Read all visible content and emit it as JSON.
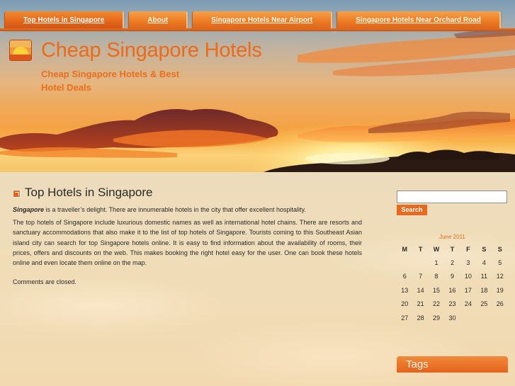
{
  "nav": {
    "items": [
      {
        "label": "Top Hotels in Singapore"
      },
      {
        "label": "About"
      },
      {
        "label": "Singapore Hotels Near Airport"
      },
      {
        "label": "Singapore Hotels Near Orchard Road"
      }
    ]
  },
  "site": {
    "title": "Cheap Singapore Hotels",
    "tagline": "Cheap Singapore Hotels & Best Hotel Deals"
  },
  "post": {
    "title": "Top Hotels in Singapore",
    "intro_bold": "Singapore",
    "intro_rest": " is a traveller’s delight. There are innumerable hotels in the city that offer excellent hospitality.",
    "paragraph": "The top hotels of Singapore include luxurious domestic names as well as international hotel chains. There are resorts and sanctuary accommodations that also make it to the list of top hotels of Singapore. Tourists coming to this Southeast Asian island city can search for top Singapore hotels online. It is easy to find information about the availability of rooms, their prices, offers and discounts on the web. This makes booking the right hotel easy for the user. One can book these hotels online and even locate them online on the map.",
    "comments_status": "Comments are closed."
  },
  "sidebar": {
    "search": {
      "value": "",
      "button_label": "Search"
    },
    "calendar": {
      "caption": "June 2011",
      "weekdays": [
        "M",
        "T",
        "W",
        "T",
        "F",
        "S",
        "S"
      ],
      "weeks": [
        [
          "",
          "",
          "1",
          "2",
          "3",
          "4",
          "5"
        ],
        [
          "6",
          "7",
          "8",
          "9",
          "10",
          "11",
          "12"
        ],
        [
          "13",
          "14",
          "15",
          "16",
          "17",
          "18",
          "19"
        ],
        [
          "20",
          "21",
          "22",
          "23",
          "24",
          "25",
          "26"
        ],
        [
          "27",
          "28",
          "29",
          "30",
          "",
          "",
          ""
        ]
      ]
    },
    "tags_heading": "Tags"
  },
  "colors": {
    "accent": "#e8691e",
    "title_orange": "#ec6a18",
    "text": "#2b2b2b"
  },
  "icons": {
    "site_logo": "sunset-logo-icon",
    "post_icon": "post-bullet-icon"
  }
}
